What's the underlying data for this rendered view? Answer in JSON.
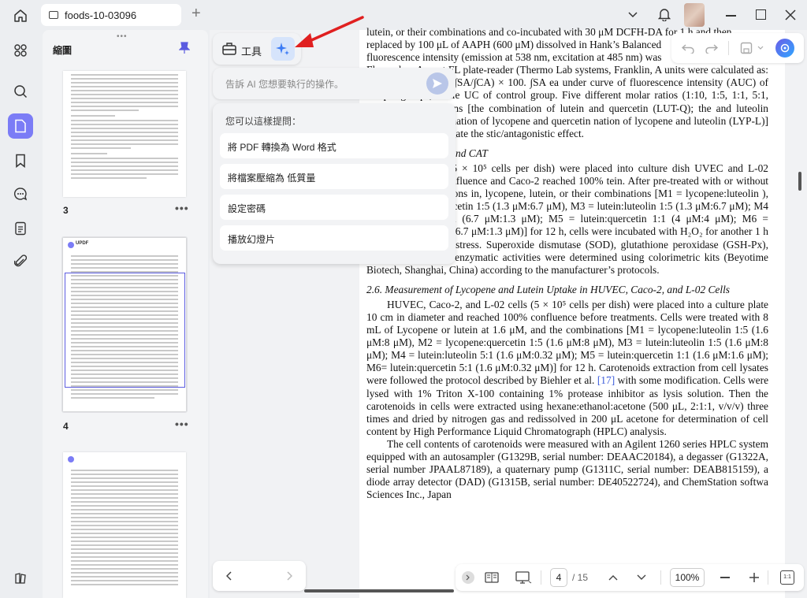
{
  "window": {
    "tab_title": "foods-10-03096",
    "new_tab": "+"
  },
  "sidebar_panel": {
    "title": "縮圖",
    "pages": [
      {
        "number": "3",
        "more": "•••"
      },
      {
        "number": "4",
        "more": "•••"
      }
    ],
    "thumb_logo": "UPDF"
  },
  "ai": {
    "tools_label": "工具",
    "input_placeholder": "告訴 AI 您想要執行的操作。",
    "suggest_header": "您可以這樣提問：",
    "suggestions": [
      "將 PDF 轉換為 Word 格式",
      "將檔案壓縮為 低質量",
      "設定密碼",
      "播放幻燈片"
    ]
  },
  "document": {
    "lines_top": [
      "lutein, or their combinations and co-incubated with 30 μM DCFH-DA for 1 h and then",
      "replaced by 100 μL of AAPH (600 μM) dissolved in Hank’s Balanced",
      "fluorescence intensity (emission at 538 nm, excitation at 485 nm) was"
    ],
    "para1": "Fluoroskan Ascent FL plate-reader (Thermo Lab systems, Franklin, A units were calculated as: CAA unit = 100 − (∫SA/∫CA) × 100. ∫SA ea under curve of fluorescence intensity (AUC) of sample groups, while UC of control group. Five different molar ratios (1:10, 1:5, 1:1, 5:1, 10:1) al combinations [the combination of lutein and quercetin (LUT-Q); the and luteolin (LUT-L); the combination of lycopene and quercetin nation of lycopene and luteolin (LYP-L)] were used to investigate the stic/antagonistic effect.",
    "h25": "s of SOD, GSH-Px, and CAT",
    "para2": "2, and L-02 cells (5 × 10⁵ cells per dish) were placed into culture dish UVEC and L-02 reached 80–90% confluence and Caco-2 reached 100% tein. After pre-treated with or without different concentrations in, lycopene, lutein, or their combinations [M1 = lycopene:luteolin ), M2 = lycopene:quercetin 1:5 (1.3 μM:6.7 μM), M3 = lutein:luteolin 1:5 (1.3 μM:6.7 μM); M4 = lutein:luteolin 5:1 (6.7 μM:1.3 μM); M5 = lutein:quercetin 1:1 (4 μM:4 μM); M6 = lutein:quercetin 5:1 (6.7 μM:1.3 μM)] for 12 h, cells were incubated with H₂O₂ for another 1 h to induce oxidative stress. Superoxide dismutase (SOD), glutathione peroxidase (GSH-Px), and catalase (CAT) enzymatic activities were determined using colorimetric kits (Beyotime Biotech, Shanghai, China) according to the manufacturer’s protocols.",
    "h26": "2.6. Measurement of Lycopene and Lutein Uptake in HUVEC, Caco-2, and L-02 Cells",
    "para3a": "HUVEC, Caco-2, and L-02 cells (5 × 10⁵ cells per dish) were placed into a culture plate 10 cm in diameter and reached 100% confluence before treatments. Cells were treated with 8 mL of Lycopene or lutein at 1.6 μM, and the combinations [M1 = lycopene:luteolin 1:5 (1.6 μM:8 μM), M2 = lycopene:quercetin 1:5 (1.6 μM:8 μM), M3 = lutein:luteolin 1:5 (1.6 μM:8 μM); M4 = lutein:luteolin 5:1 (1.6 μM:0.32 μM); M5 = lutein:quercetin 1:1 (1.6 μM:1.6 μM); M6= lutein:quercetin 5:1 (1.6 μM:0.32 μM)] for 12 h. Carotenoids extraction from cell lysates were followed the protocol described by Biehler et al. ",
    "para3cite": "[17]",
    "para3b": " with some modification. Cells were lysed with 1% Triton X-100 containing 1% protease inhibitor as lysis solution. Then the carotenoids in cells were extracted using hexane:ethanol:acetone (500 μL, 2:1:1, v/v/v) three times and dried by nitrogen gas and redissolved in 200 μL acetone for determination of cell content by High Performance Liquid Chromatograph (HPLC) analysis.",
    "para4": "The cell contents of carotenoids were measured with an Agilent 1260 series HPLC system equipped with an autosampler (G1329B, serial number: DEAAC20184), a degasser (G1322A, serial number JPAAL87189), a quaternary pump (G1311C, serial number: DEAB815159), a diode array detector (DAD) (G1315B, serial number: DE40522724), and ChemStation softwa Sciences Inc., Japan"
  },
  "pager": {
    "current": "4",
    "total": "/ 15",
    "zoom": "100%",
    "fit_label": "1:1"
  }
}
